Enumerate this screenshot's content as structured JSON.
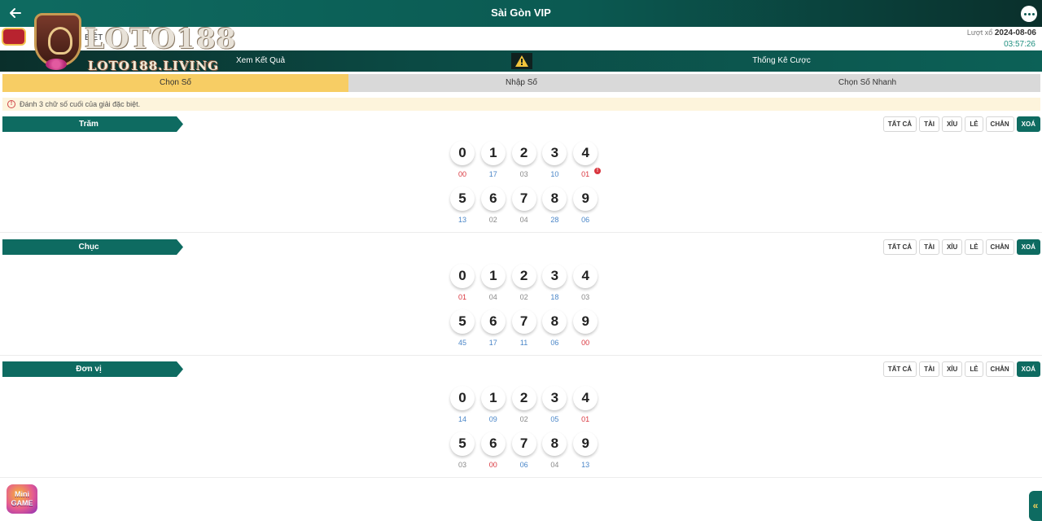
{
  "header": {
    "title": "Sài Gòn VIP"
  },
  "brand": {
    "name": "LOTO188",
    "domain": "LOTO188.LIVING"
  },
  "info": {
    "tag": "BIỆT",
    "draw_label": "Lượt xổ",
    "draw_date": "2024-08-06",
    "countdown": "03:57:26"
  },
  "nav": {
    "left": "Xem Kết Quả",
    "right": "Thống Kê Cược"
  },
  "tabs": [
    "Chọn Số",
    "Nhập Số",
    "Chọn Số Nhanh"
  ],
  "notice": "Đánh 3 chữ số cuối của giải đặc biệt.",
  "quick_buttons": [
    "TẤT CẢ",
    "TÀI",
    "XỈU",
    "LẺ",
    "CHẴN",
    "XOÁ"
  ],
  "colors": {
    "primary": "#0e6b61",
    "active_tab": "#f7cd64",
    "hot": "#d9363e",
    "cold": "#4a86c8",
    "neutral": "#888888"
  },
  "sections": [
    {
      "label": "Trăm",
      "hot_badge": "!",
      "balls": [
        {
          "digit": "0",
          "count": "00",
          "tone": "hot"
        },
        {
          "digit": "1",
          "count": "17",
          "tone": "cold"
        },
        {
          "digit": "2",
          "count": "03",
          "tone": "neutral"
        },
        {
          "digit": "3",
          "count": "10",
          "tone": "cold"
        },
        {
          "digit": "4",
          "count": "01",
          "tone": "hot"
        },
        {
          "digit": "5",
          "count": "13",
          "tone": "cold"
        },
        {
          "digit": "6",
          "count": "02",
          "tone": "neutral"
        },
        {
          "digit": "7",
          "count": "04",
          "tone": "neutral"
        },
        {
          "digit": "8",
          "count": "28",
          "tone": "cold"
        },
        {
          "digit": "9",
          "count": "06",
          "tone": "cold"
        }
      ]
    },
    {
      "label": "Chục",
      "balls": [
        {
          "digit": "0",
          "count": "01",
          "tone": "hot"
        },
        {
          "digit": "1",
          "count": "04",
          "tone": "neutral"
        },
        {
          "digit": "2",
          "count": "02",
          "tone": "neutral"
        },
        {
          "digit": "3",
          "count": "18",
          "tone": "cold"
        },
        {
          "digit": "4",
          "count": "03",
          "tone": "neutral"
        },
        {
          "digit": "5",
          "count": "45",
          "tone": "cold"
        },
        {
          "digit": "6",
          "count": "17",
          "tone": "cold"
        },
        {
          "digit": "7",
          "count": "11",
          "tone": "cold"
        },
        {
          "digit": "8",
          "count": "06",
          "tone": "cold"
        },
        {
          "digit": "9",
          "count": "00",
          "tone": "hot"
        }
      ]
    },
    {
      "label": "Đơn vị",
      "balls": [
        {
          "digit": "0",
          "count": "14",
          "tone": "cold"
        },
        {
          "digit": "1",
          "count": "09",
          "tone": "cold"
        },
        {
          "digit": "2",
          "count": "02",
          "tone": "neutral"
        },
        {
          "digit": "3",
          "count": "05",
          "tone": "cold"
        },
        {
          "digit": "4",
          "count": "01",
          "tone": "hot"
        },
        {
          "digit": "5",
          "count": "03",
          "tone": "neutral"
        },
        {
          "digit": "6",
          "count": "00",
          "tone": "hot"
        },
        {
          "digit": "7",
          "count": "06",
          "tone": "cold"
        },
        {
          "digit": "8",
          "count": "04",
          "tone": "neutral"
        },
        {
          "digit": "9",
          "count": "13",
          "tone": "cold"
        }
      ]
    }
  ],
  "mini_game": {
    "label": "Mini GAME"
  },
  "side_tab": {
    "icon": "«"
  }
}
